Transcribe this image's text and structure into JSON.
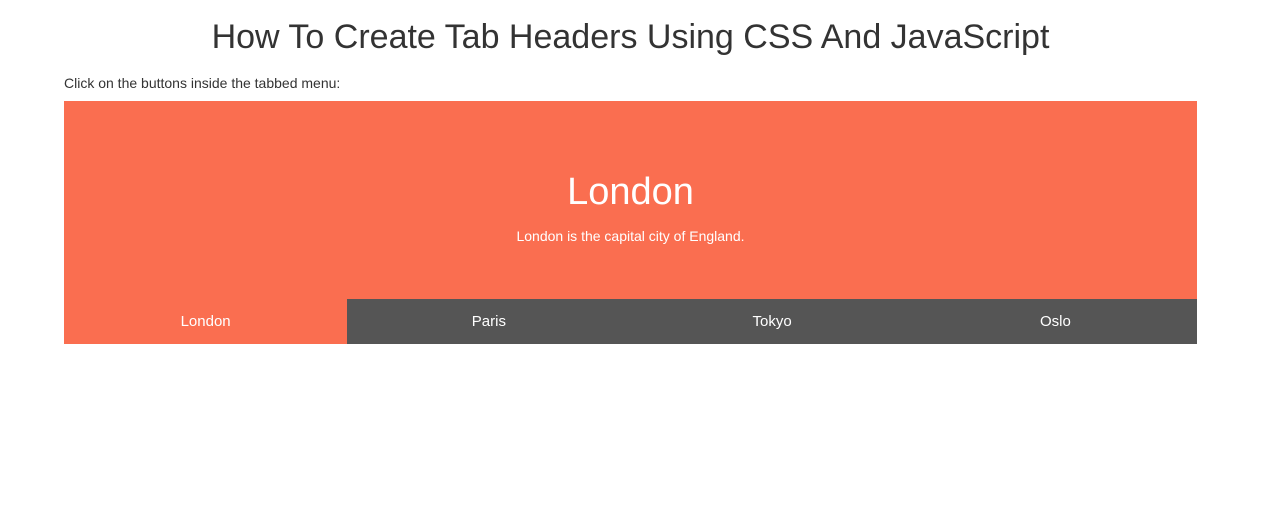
{
  "header": {
    "title": "How To Create Tab Headers Using CSS And JavaScript",
    "instruction": "Click on the buttons inside the tabbed menu:"
  },
  "content": {
    "active_tab_heading": "London",
    "active_tab_description": "London is the capital city of England."
  },
  "tabs": {
    "items": [
      {
        "label": "London",
        "active": true
      },
      {
        "label": "Paris",
        "active": false
      },
      {
        "label": "Tokyo",
        "active": false
      },
      {
        "label": "Oslo",
        "active": false
      }
    ]
  },
  "colors": {
    "accent": "#fa6e50",
    "tab_inactive": "#555555",
    "tab_text": "#ffffff"
  }
}
